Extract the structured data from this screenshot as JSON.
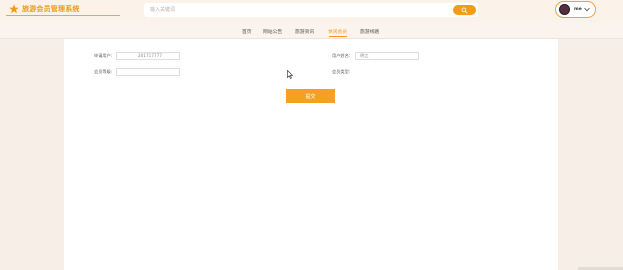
{
  "header": {
    "logo_text": "旅游会员管理系统",
    "search_placeholder": "输入关键词",
    "user_name": "me"
  },
  "nav": {
    "items": [
      {
        "label": "首页",
        "active": false
      },
      {
        "label": "网站公告",
        "active": false
      },
      {
        "label": "旅游资讯",
        "active": false
      },
      {
        "label": "休闲会员",
        "active": true
      },
      {
        "label": "旅游线路",
        "active": false
      }
    ]
  },
  "form": {
    "field1_label": "申请用户:",
    "field1_value": "201717777",
    "field2_label": "用户姓名:",
    "field2_value": "明江",
    "field3_label": "会员等级:",
    "field3_value": "",
    "field4_label": "会员类型:",
    "submit_label": "提交"
  },
  "colors": {
    "accent": "#f39a1f",
    "background": "#f6eee7"
  }
}
